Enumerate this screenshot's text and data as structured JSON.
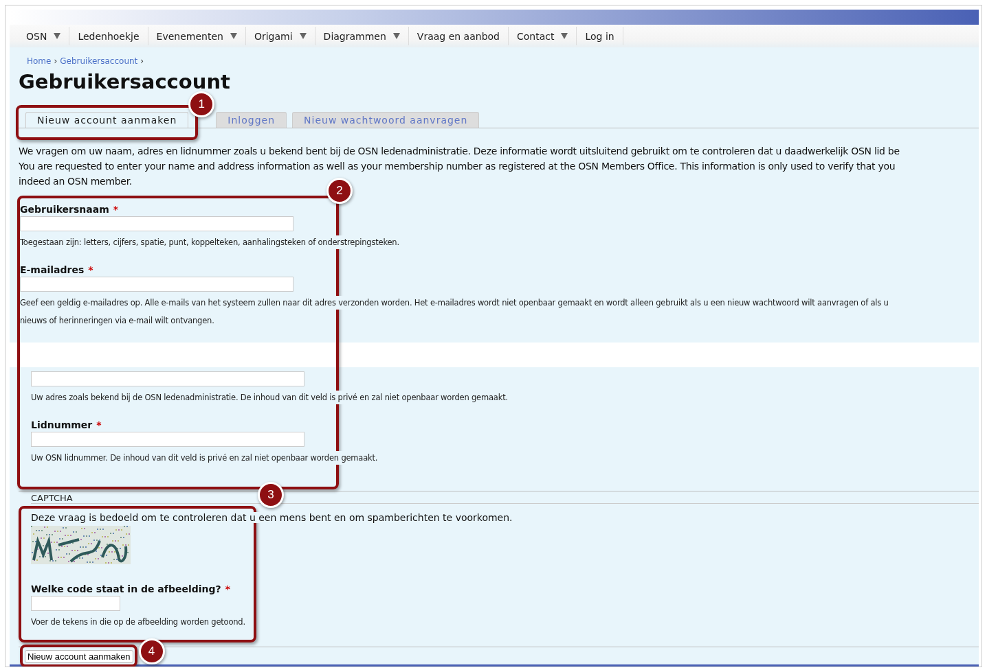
{
  "nav": [
    {
      "label": "OSN",
      "has_menu": true
    },
    {
      "label": "Ledenhoekje",
      "has_menu": false
    },
    {
      "label": "Evenementen",
      "has_menu": true
    },
    {
      "label": "Origami",
      "has_menu": true
    },
    {
      "label": "Diagrammen",
      "has_menu": true
    },
    {
      "label": "Vraag en aanbod",
      "has_menu": false
    },
    {
      "label": "Contact",
      "has_menu": true
    },
    {
      "label": "Log in",
      "has_menu": false
    }
  ],
  "breadcrumb": [
    "Home",
    "Gebruikersaccount"
  ],
  "breadcrumb_separator": "›",
  "title": "Gebruikersaccount",
  "tabs": [
    {
      "label": "Nieuw account aanmaken",
      "selected": true
    },
    {
      "label": "Inloggen",
      "selected": false
    },
    {
      "label": "Nieuw wachtwoord aanvragen",
      "selected": false
    }
  ],
  "intro_lines": [
    "We vragen om uw naam, adres en lidnummer zoals u bekend bent bij de OSN ledenadministratie. Deze informatie wordt uitsluitend gebruikt om te controleren dat u daadwerkelijk OSN lid be",
    "You are requested to enter your name and address information as well as your membership number as registered at the OSN Members Office. This information is only used to verify that you",
    "indeed an OSN member."
  ],
  "fields_top": [
    {
      "label": "Gebruikersnaam",
      "mark": "*",
      "description_lines": [
        "Toegestaan zijn: letters, cijfers, spatie, punt, koppelteken, aanhalingsteken of onderstrepingsteken."
      ]
    },
    {
      "label": "E-mailadres",
      "mark": "*",
      "description_lines": [
        "Geef een geldig e-mailadres op. Alle e-mails van het systeem zullen naar dit adres verzonden worden. Het e-mailadres wordt niet openbaar gemaakt en wordt alleen gebruikt als u een nieuw wachtwoord wilt aanvragen of als u",
        "nieuws of herinneringen via e-mail wilt ontvangen."
      ]
    }
  ],
  "fields_bottom": [
    {
      "description_lines": [
        "Uw adres zoals bekend bij de OSN ledenadministratie. De inhoud van dit veld is privé en zal niet openbaar worden gemaakt."
      ]
    },
    {
      "label": "Lidnummer",
      "mark": "*",
      "description_lines": [
        "Uw OSN lidnummer. De inhoud van dit veld is privé en zal niet openbaar worden gemaakt."
      ]
    }
  ],
  "captcha": {
    "legend": "CAPTCHA",
    "text": "Deze vraag is bedoeld om te controleren dat u een mens bent en om spamberichten te voorkomen.",
    "label": "Welke code staat in de afbeelding?",
    "mark": "*",
    "description": "Voer de tekens in die op de afbeelding worden getoond."
  },
  "submit": "Nieuw account aanmaken",
  "callouts": [
    "1",
    "2",
    "3",
    "4"
  ]
}
